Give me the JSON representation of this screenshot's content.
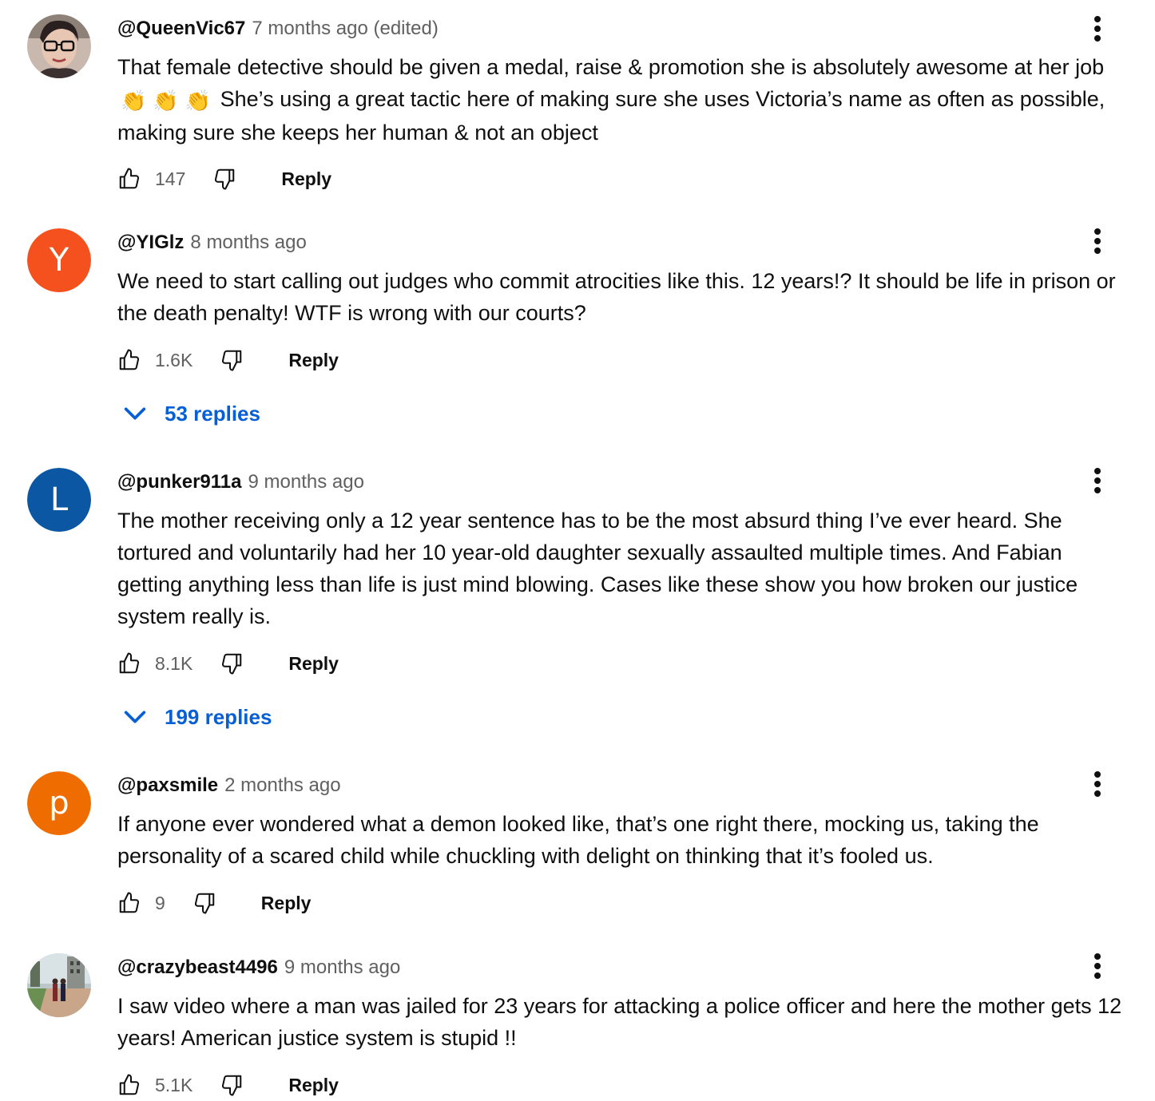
{
  "comments": [
    {
      "author": "@QueenVic67",
      "time": "7 months ago (edited)",
      "text_part1": "That female detective should be given a medal, raise & promotion she is absolutely awesome at her job",
      "emoji": "👏",
      "text_part2": "She’s using a great tactic here of making sure she uses Victoria’s name as often as possible, making sure she keeps her human & not an object",
      "likes": "147",
      "reply_label": "Reply",
      "avatar_type": "photo-portrait"
    },
    {
      "author": "@YIGlz",
      "time": "8 months ago",
      "text": "We need to start calling out judges who commit atrocities like this. 12 years!? It should be life in prison or the death penalty! WTF is wrong with our courts?",
      "likes": "1.6K",
      "reply_label": "Reply",
      "replies_label": "53 replies",
      "avatar_letter": "Y",
      "avatar_color": "#f4511e"
    },
    {
      "author": "@punker911a",
      "time": "9 months ago",
      "text": "The mother receiving only a 12 year sentence has to be the most absurd thing I’ve ever heard. She tortured and voluntarily had her 10 year-old daughter sexually assaulted multiple times. And Fabian getting anything less than life is just mind blowing. Cases like these show you how broken our justice system really is.",
      "likes": "8.1K",
      "reply_label": "Reply",
      "replies_label": "199 replies",
      "avatar_letter": "L",
      "avatar_color": "#0b57a4"
    },
    {
      "author": "@paxsmile",
      "time": "2 months ago",
      "text": "If anyone ever wondered what a demon looked like, that’s one right there, mocking us, taking the personality of a scared child while chuckling with delight on thinking that it’s fooled us.",
      "likes": "9",
      "reply_label": "Reply",
      "avatar_letter": "p",
      "avatar_color": "#ef6c00"
    },
    {
      "author": "@crazybeast4496",
      "time": "9 months ago",
      "text": "I saw video where a man was jailed for 23 years for attacking a police officer and here the mother gets 12 years! American justice system is stupid !!",
      "likes": "5.1K",
      "reply_label": "Reply",
      "avatar_type": "photo-street"
    }
  ],
  "icons": {
    "like": "thumbs-up-icon",
    "dislike": "thumbs-down-icon",
    "menu": "more-vert-icon",
    "expand": "chevron-down-icon"
  },
  "colors": {
    "link_blue": "#065fd4",
    "secondary_text": "#606060"
  }
}
